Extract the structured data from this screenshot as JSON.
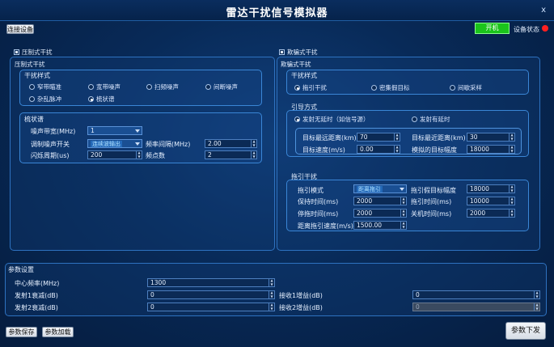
{
  "window": {
    "title": "雷达干扰信号模拟器",
    "close": "x"
  },
  "toolbar": {
    "connect": "连接设备",
    "power": "开机",
    "device_status": "设备状态",
    "status_color": "#ff2020",
    "power_color": "#20d020"
  },
  "left": {
    "group_check": "压制式干扰",
    "group_title": "压制式干扰",
    "style_title": "干扰样式",
    "styles": [
      "窄带瞄准",
      "宽带噪声",
      "扫频噪声",
      "间断噪声",
      "杂乱脉冲",
      "梳状谱"
    ],
    "selected_style": "梳状谱",
    "comb_title": "梳状谱",
    "noise_bw_label": "噪声带宽(MHz)",
    "noise_bw_value": "1",
    "mod_switch_label": "调制噪声开关",
    "mod_switch_value": "连续波输出",
    "freq_interval_label": "频率间隔(MHz)",
    "freq_interval_value": "2.00",
    "flash_period_label": "闪烁周期(us)",
    "flash_period_value": "200",
    "freq_points_label": "频点数",
    "freq_points_value": "2"
  },
  "right": {
    "group_check": "欺骗式干扰",
    "group_title": "欺骗式干扰",
    "style_title": "干扰样式",
    "styles": [
      "拖引干扰",
      "密集假目标",
      "间歇采样"
    ],
    "selected_style": "拖引干扰",
    "guide_title": "引导方式",
    "guide_modes": [
      "发射无延时（如信号源）",
      "发射有延时"
    ],
    "selected_guide": "发射无延时（如信号源）",
    "max_dist_label": "目标最远距离(km)",
    "max_dist_value": "70",
    "min_dist_label": "目标最近距离(km)",
    "min_dist_value": "30",
    "speed_label": "目标速度(m/s)",
    "speed_value": "0.00",
    "amp_label": "模拟的目标幅度",
    "amp_value": "18000",
    "pull_title": "拖引干扰",
    "pull_mode_label": "拖引模式",
    "pull_mode_value": "距离拖引",
    "pull_amp_label": "拖引假目标幅度",
    "pull_amp_value": "18000",
    "hold_label": "保持时间(ms)",
    "hold_value": "2000",
    "pull_time_label": "拖引时间(ms)",
    "pull_time_value": "10000",
    "stop_label": "停拖时间(ms)",
    "stop_value": "2000",
    "off_label": "关机时间(ms)",
    "off_value": "2000",
    "pull_speed_label": "距离拖引速度(m/s)",
    "pull_speed_value": "1500.00"
  },
  "params": {
    "title": "参数设置",
    "center_label": "中心频率(MHz)",
    "center_value": "1300",
    "tx1_label": "发射1衰减(dB)",
    "tx1_value": "0",
    "rx1_label": "接收1增益(dB)",
    "rx1_value": "0",
    "tx2_label": "发射2衰减(dB)",
    "tx2_value": "0",
    "rx2_label": "接收2增益(dB)",
    "rx2_value": "0"
  },
  "bottom": {
    "save": "参数保存",
    "load": "参数加载",
    "send": "参数下发"
  }
}
